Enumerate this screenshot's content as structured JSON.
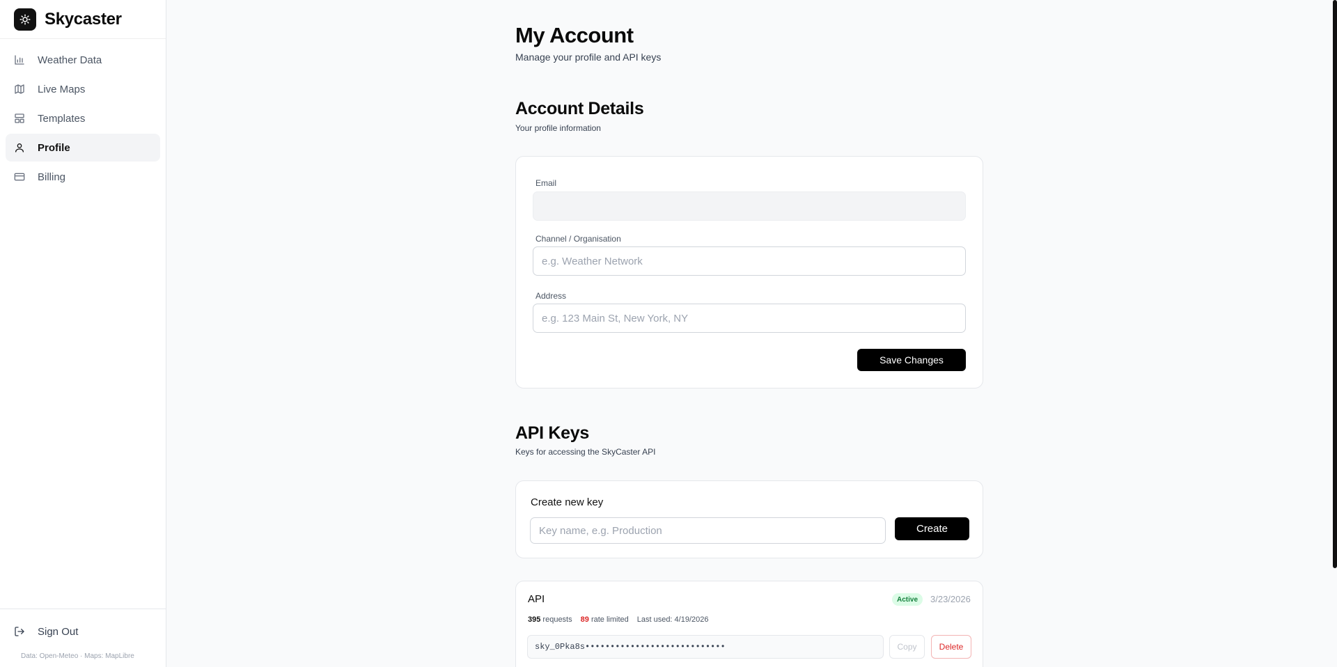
{
  "app": {
    "name": "Skycaster"
  },
  "sidebar": {
    "items": [
      {
        "label": "Weather Data",
        "icon": "bar-chart-icon"
      },
      {
        "label": "Live Maps",
        "icon": "map-icon"
      },
      {
        "label": "Templates",
        "icon": "layout-icon"
      },
      {
        "label": "Profile",
        "icon": "user-icon",
        "active": true
      },
      {
        "label": "Billing",
        "icon": "credit-card-icon"
      }
    ],
    "signout_label": "Sign Out",
    "footnote": "Data: Open-Meteo · Maps: MapLibre"
  },
  "page": {
    "title": "My Account",
    "subtitle": "Manage your profile and API keys"
  },
  "account": {
    "title": "Account Details",
    "subtitle": "Your profile information",
    "email_label": "Email",
    "email_value": "",
    "org_label": "Channel / Organisation",
    "org_placeholder": "e.g. Weather Network",
    "address_label": "Address",
    "address_placeholder": "e.g. 123 Main St, New York, NY",
    "save_label": "Save Changes"
  },
  "api_keys": {
    "title": "API Keys",
    "subtitle": "Keys for accessing the SkyCaster API",
    "create_title": "Create new key",
    "create_placeholder": "Key name, e.g. Production",
    "create_label": "Create",
    "keys": [
      {
        "name": "API",
        "status": "Active",
        "created": "3/23/2026",
        "requests": "395",
        "requests_label": "requests",
        "rate_limited": "89",
        "rate_limited_label": "rate limited",
        "last_used": "Last used: 4/19/2026",
        "masked_key": "sky_0Pka8s••••••••••••••••••••••••••••",
        "copy_label": "Copy",
        "delete_label": "Delete"
      }
    ]
  },
  "colors": {
    "accent": "#000000",
    "active_badge_bg": "#dcfce7",
    "active_badge_text": "#15803d",
    "danger": "#dc2626"
  }
}
